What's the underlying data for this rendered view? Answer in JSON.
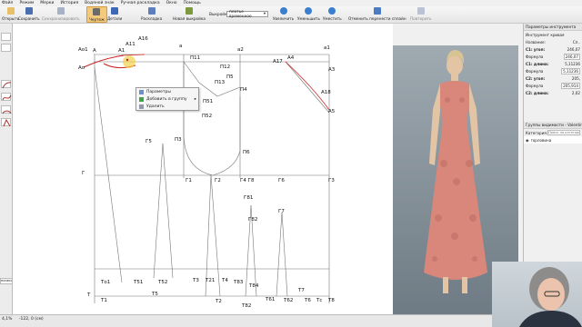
{
  "menu": [
    "Файл",
    "Режим",
    "Мерки",
    "История",
    "Водяной знак",
    "Ручная раскладка",
    "Окно",
    "Помощь"
  ],
  "toolbar": {
    "open": "Открыть",
    "save": "Сохранить",
    "save_sync": "Синхронизировать",
    "draw": "Чертеж",
    "details": "Детали",
    "layout": "Раскладка",
    "new_pattern": "Новая выкройка",
    "pattern_label": "Выкройка:",
    "pattern_value": "платье временное",
    "zoom_in": "Увеличить",
    "zoom_out": "Уменьшить",
    "fit": "Уместить",
    "undo": "Отменить перенести сплайн",
    "redo": "Повторить"
  },
  "left_panel": {
    "label": "ническая д..."
  },
  "context_menu": {
    "items": [
      {
        "label": "Параметры",
        "icon": "settings-icon"
      },
      {
        "label": "Добавить в группу",
        "icon": "add-icon"
      },
      {
        "label": "Удалить",
        "icon": "delete-icon"
      }
    ]
  },
  "points": {
    "Ao1": "Ао1",
    "A": "А",
    "A1": "А1",
    "A11": "А11",
    "A16": "А16",
    "Ao": "Ао",
    "a": "а",
    "a2": "а2",
    "a1": "а1",
    "A17": "А17",
    "A4": "А4",
    "A3": "А3",
    "A18": "А18",
    "A5": "А5",
    "P11": "П11",
    "P12": "П12",
    "P13": "П13",
    "P5": "П5",
    "P4": "П4",
    "P51": "П51",
    "P52": "П52",
    "P3": "П3",
    "P6": "П6",
    "G5": "Г5",
    "G": "Г",
    "G1": "Г1",
    "G2": "Г2",
    "G4G8": "Г4 Г8",
    "G6": "Г6",
    "G3": "Г3",
    "G81": "Г81",
    "G82": "Г82",
    "G7": "Г7",
    "To1": "То1",
    "T51": "Т51",
    "T52": "Т52",
    "T3": "Т3",
    "T21": "Т21",
    "T4": "Т4",
    "T83": "Т83",
    "T84": "Т84",
    "T7": "Т7",
    "T": "Т",
    "T1": "Т1",
    "T5": "Т5",
    "T2": "Т2",
    "T61": "Т61",
    "T62": "Т62",
    "T6": "Т6",
    "Tc": "Тс",
    "T8": "Т8",
    "T82": "Т82"
  },
  "right_panel": {
    "title": "Параметры инструмента",
    "subtitle": "Инструмент кривая",
    "name_label": "Название:",
    "name_value": "Сп..",
    "c1_angle_label": "C1: угол:",
    "c1_angle_value": "246,07",
    "formula_label": "Формула",
    "formula1": "246,07",
    "c1_len_label": "C1: длина:",
    "c1_len_value": "5,11236",
    "formula2": "5,11236",
    "c2_angle_label": "C2: угол:",
    "c2_angle_value": "205,",
    "formula3": "205,914",
    "c2_len_label": "C2: длина:",
    "c2_len_value": "2,02",
    "groups_title": "Группы видимости - Valentina",
    "category_label": "Категория:",
    "category_placeholder": "Поиск по категории",
    "group_item": "горловина"
  },
  "status": {
    "zoom": "4,1%",
    "coords": "-122, 0 (см)"
  }
}
